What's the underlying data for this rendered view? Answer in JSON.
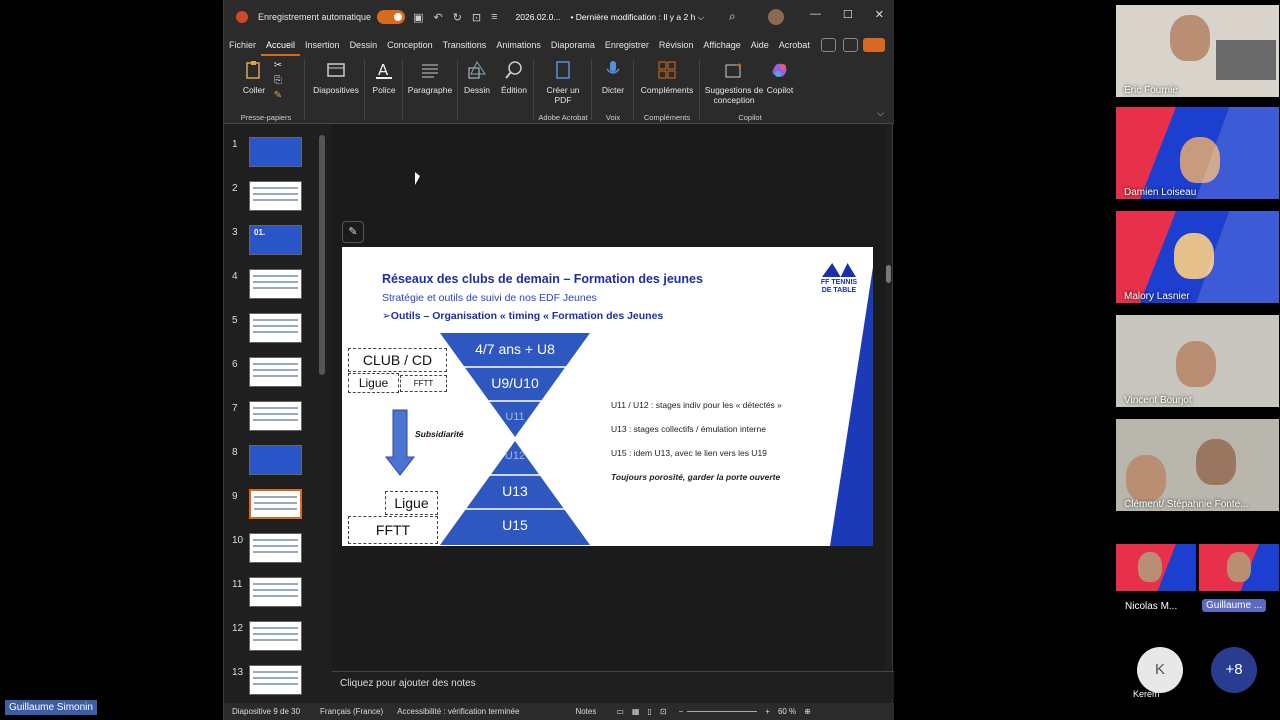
{
  "titlebar": {
    "autosave_label": "Enregistrement automatique",
    "doc_name": "2026.02.0...",
    "modified": "• Dernière modification : Il y a 2 h ⌵"
  },
  "tabs": [
    "Fichier",
    "Accueil",
    "Insertion",
    "Dessin",
    "Conception",
    "Transitions",
    "Animations",
    "Diaporama",
    "Enregistrer",
    "Révision",
    "Affichage",
    "Aide",
    "Acrobat"
  ],
  "ribbon": {
    "coller": "Coller",
    "presse_papiers": "Presse-papiers",
    "diapositives": "Diapositives",
    "police": "Police",
    "paragraphe": "Paragraphe",
    "dessin": "Dessin",
    "edition": "Édition",
    "creer_pdf": "Créer un PDF",
    "adobe_acrobat": "Adobe Acrobat",
    "dicter": "Dicter",
    "voix": "Voix",
    "complements": "Compléments",
    "complements_grp": "Compléments",
    "suggestions": "Suggestions de conception",
    "copilot": "Copilot",
    "copilot_grp": "Copilot"
  },
  "thumbnails": [
    "1",
    "2",
    "3",
    "4",
    "5",
    "6",
    "7",
    "8",
    "9",
    "10",
    "11",
    "12",
    "13"
  ],
  "thumb3_text": "01.",
  "slide": {
    "title": "Réseaux des clubs de demain – Formation des jeunes",
    "subtitle": "Stratégie et outils de suivi de nos EDF Jeunes",
    "subtitle2": "➢Outils – Organisation « timing «  Formation des Jeunes",
    "logo_text": "FF TENNIS DE TABLE",
    "club_cd": "CLUB / CD",
    "ligue": "Ligue",
    "fftt": "FFTT",
    "subsidiarite": "Subsidiarité",
    "ligue2": "Ligue",
    "fftt2": "FFTT",
    "tri": [
      "4/7 ans + U8",
      "U9/U10",
      "U11",
      "U12",
      "U13",
      "U15"
    ],
    "notes": [
      "U11 / U12 : stages indiv pour les « détectés »",
      "U13 : stages collectifs / émulation interne",
      "U15 : idem U13, avec le lien vers les U19",
      "Toujours porosité, garder la porte ouverte"
    ]
  },
  "notes_placeholder": "Cliquez pour ajouter des notes",
  "status": {
    "slide": "Diapositive 9 de 30",
    "lang": "Français (France)",
    "access": "Accessibilité : vérification terminée",
    "notes": "Notes",
    "zoom": "60 %"
  },
  "participants": [
    "Eric Fournie",
    "Damien Loiseau",
    "Malory Lasnier",
    "Vincent Bourjot",
    "Clément/ Stépahnie Fonte...",
    "Nicolas M...",
    "Guillaume ..."
  ],
  "extra": {
    "k_initial": "K",
    "k_name": "Kerem",
    "more": "+8"
  },
  "self_name": "Guillaume Simonin",
  "colors": {
    "accent": "#d86a1f",
    "slide_blue": "#2a55c8",
    "title_blue": "#1a2fa8"
  }
}
